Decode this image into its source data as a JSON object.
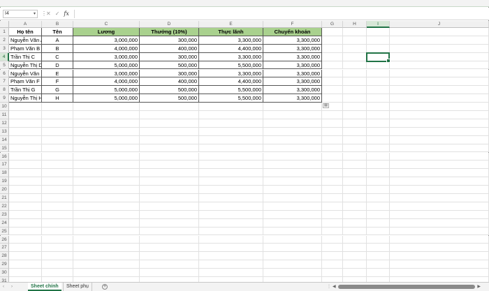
{
  "formula_bar": {
    "name_box": "I4",
    "formula": ""
  },
  "columns": [
    "A",
    "B",
    "C",
    "D",
    "E",
    "F",
    "G",
    "H",
    "I",
    "J"
  ],
  "row_numbers": [
    "1",
    "2",
    "3",
    "4",
    "5",
    "6",
    "7",
    "8",
    "9",
    "10",
    "11",
    "12",
    "13",
    "14",
    "15",
    "16",
    "17",
    "18",
    "19",
    "20",
    "21",
    "22",
    "23",
    "24",
    "25",
    "26",
    "27",
    "28",
    "29",
    "30",
    "31"
  ],
  "table": {
    "headers": [
      "Họ tên",
      "Tên",
      "Lương",
      "Thưởng (10%)",
      "Thực lãnh",
      "Chuyển khoản"
    ],
    "rows": [
      [
        "Nguyễn Văn A",
        "A",
        "3,000,000",
        "300,000",
        "3,300,000",
        "3,300,000"
      ],
      [
        "Phạm Văn B",
        "B",
        "4,000,000",
        "400,000",
        "4,400,000",
        "3,300,000"
      ],
      [
        "Trần Thị C",
        "C",
        "3,000,000",
        "300,000",
        "3,300,000",
        "3,300,000"
      ],
      [
        "Nguyễn Thị D",
        "D",
        "5,000,000",
        "500,000",
        "5,500,000",
        "3,300,000"
      ],
      [
        "Nguyễn Văn E",
        "E",
        "3,000,000",
        "300,000",
        "3,300,000",
        "3,300,000"
      ],
      [
        "Phạm Văn F",
        "F",
        "4,000,000",
        "400,000",
        "4,400,000",
        "3,300,000"
      ],
      [
        "Trần Thị G",
        "G",
        "5,000,000",
        "500,000",
        "5,500,000",
        "3,300,000"
      ],
      [
        "Nguyễn Thị H",
        "H",
        "5,000,000",
        "500,000",
        "5,500,000",
        "3,300,000"
      ]
    ]
  },
  "sheets": [
    "Sheet chính",
    "Sheet phụ"
  ],
  "active_sheet": "Sheet chính",
  "colors": {
    "accent": "#217346",
    "header_fill": "#a9d18e"
  }
}
